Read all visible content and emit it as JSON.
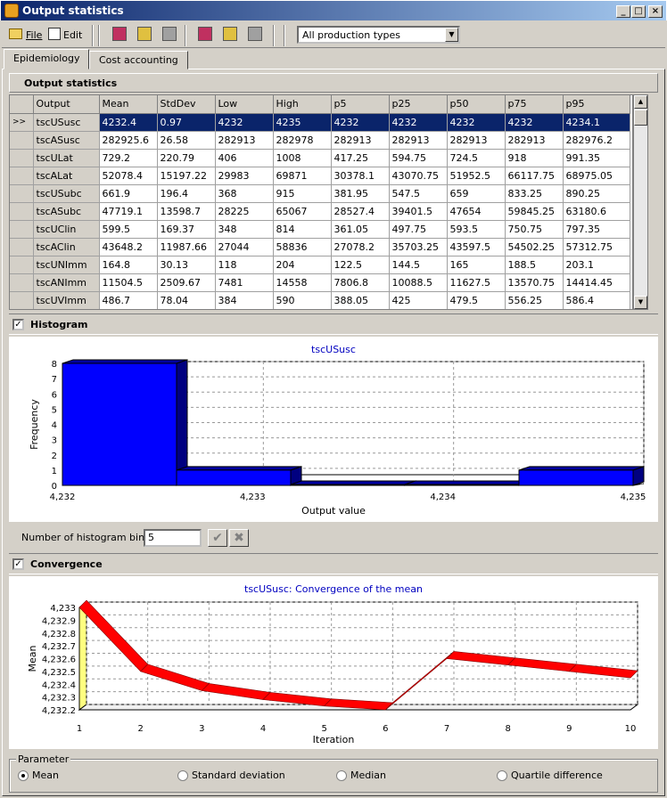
{
  "window": {
    "title": "Output statistics"
  },
  "menu": {
    "file": "File",
    "edit": "Edit"
  },
  "filter": {
    "selected": "All production types"
  },
  "tabs": [
    {
      "label": "Epidemiology"
    },
    {
      "label": "Cost accounting"
    }
  ],
  "stats": {
    "title": "Output statistics",
    "columns": [
      "Output",
      "Mean",
      "StdDev",
      "Low",
      "High",
      "p5",
      "p25",
      "p50",
      "p75",
      "p95"
    ],
    "selected_marker": ">>",
    "rows": [
      [
        "tscUSusc",
        "4232.4",
        "0.97",
        "4232",
        "4235",
        "4232",
        "4232",
        "4232",
        "4232",
        "4234.1"
      ],
      [
        "tscASusc",
        "282925.6",
        "26.58",
        "282913",
        "282978",
        "282913",
        "282913",
        "282913",
        "282913",
        "282976.2"
      ],
      [
        "tscULat",
        "729.2",
        "220.79",
        "406",
        "1008",
        "417.25",
        "594.75",
        "724.5",
        "918",
        "991.35"
      ],
      [
        "tscALat",
        "52078.4",
        "15197.22",
        "29983",
        "69871",
        "30378.1",
        "43070.75",
        "51952.5",
        "66117.75",
        "68975.05"
      ],
      [
        "tscUSubc",
        "661.9",
        "196.4",
        "368",
        "915",
        "381.95",
        "547.5",
        "659",
        "833.25",
        "890.25"
      ],
      [
        "tscASubc",
        "47719.1",
        "13598.7",
        "28225",
        "65067",
        "28527.4",
        "39401.5",
        "47654",
        "59845.25",
        "63180.6"
      ],
      [
        "tscUClin",
        "599.5",
        "169.37",
        "348",
        "814",
        "361.05",
        "497.75",
        "593.5",
        "750.75",
        "797.35"
      ],
      [
        "tscAClin",
        "43648.2",
        "11987.66",
        "27044",
        "58836",
        "27078.2",
        "35703.25",
        "43597.5",
        "54502.25",
        "57312.75"
      ],
      [
        "tscUNImm",
        "164.8",
        "30.13",
        "118",
        "204",
        "122.5",
        "144.5",
        "165",
        "188.5",
        "203.1"
      ],
      [
        "tscANImm",
        "11504.5",
        "2509.67",
        "7481",
        "14558",
        "7806.8",
        "10088.5",
        "11627.5",
        "13570.75",
        "14414.45"
      ],
      [
        "tscUVImm",
        "486.7",
        "78.04",
        "384",
        "590",
        "388.05",
        "425",
        "479.5",
        "556.25",
        "586.4"
      ]
    ]
  },
  "histogram": {
    "section_label": "Histogram",
    "bins_label": "Number of histogram bins:",
    "bins_value": "5",
    "checked": true
  },
  "convergence": {
    "section_label": "Convergence",
    "checked": true,
    "parameter_label": "Parameter",
    "options": [
      "Mean",
      "Standard deviation",
      "Median",
      "Quartile difference"
    ],
    "selected": "Mean"
  },
  "chart_data": [
    {
      "type": "bar",
      "title": "tscUSusc",
      "xlabel": "Output value",
      "ylabel": "Frequency",
      "xticks": [
        "4,232",
        "4,233",
        "4,234",
        "4,235"
      ],
      "yticks": [
        "0",
        "1",
        "2",
        "3",
        "4",
        "5",
        "6",
        "7",
        "8"
      ],
      "bins": [
        [
          4232,
          4232.6
        ],
        [
          4232.6,
          4233.2
        ],
        [
          4233.2,
          4233.8
        ],
        [
          4233.8,
          4234.4
        ],
        [
          4234.4,
          4235
        ]
      ],
      "values": [
        8,
        1,
        0,
        0,
        1
      ],
      "xlim": [
        4232,
        4235
      ],
      "ylim": [
        0,
        8
      ],
      "grid": true,
      "color": "#0000ff"
    },
    {
      "type": "line",
      "title": "tscUSusc: Convergence of the mean",
      "xlabel": "Iteration",
      "ylabel": "Mean",
      "x": [
        1,
        2,
        3,
        4,
        5,
        6,
        7,
        8,
        9,
        10
      ],
      "y": [
        4233,
        4232.5,
        4232.35,
        4232.28,
        4232.23,
        4232.2,
        4232.6,
        4232.55,
        4232.5,
        4232.45
      ],
      "xticks": [
        "1",
        "2",
        "3",
        "4",
        "5",
        "6",
        "7",
        "8",
        "9",
        "10"
      ],
      "yticks": [
        "4,233",
        "4,232.9",
        "4,232.8",
        "4,232.7",
        "4,232.6",
        "4,232.5",
        "4,232.4",
        "4,232.3",
        "4,232.2"
      ],
      "xlim": [
        1,
        10
      ],
      "ylim": [
        4232.2,
        4233
      ],
      "grid": true,
      "color": "#ff0000"
    }
  ]
}
